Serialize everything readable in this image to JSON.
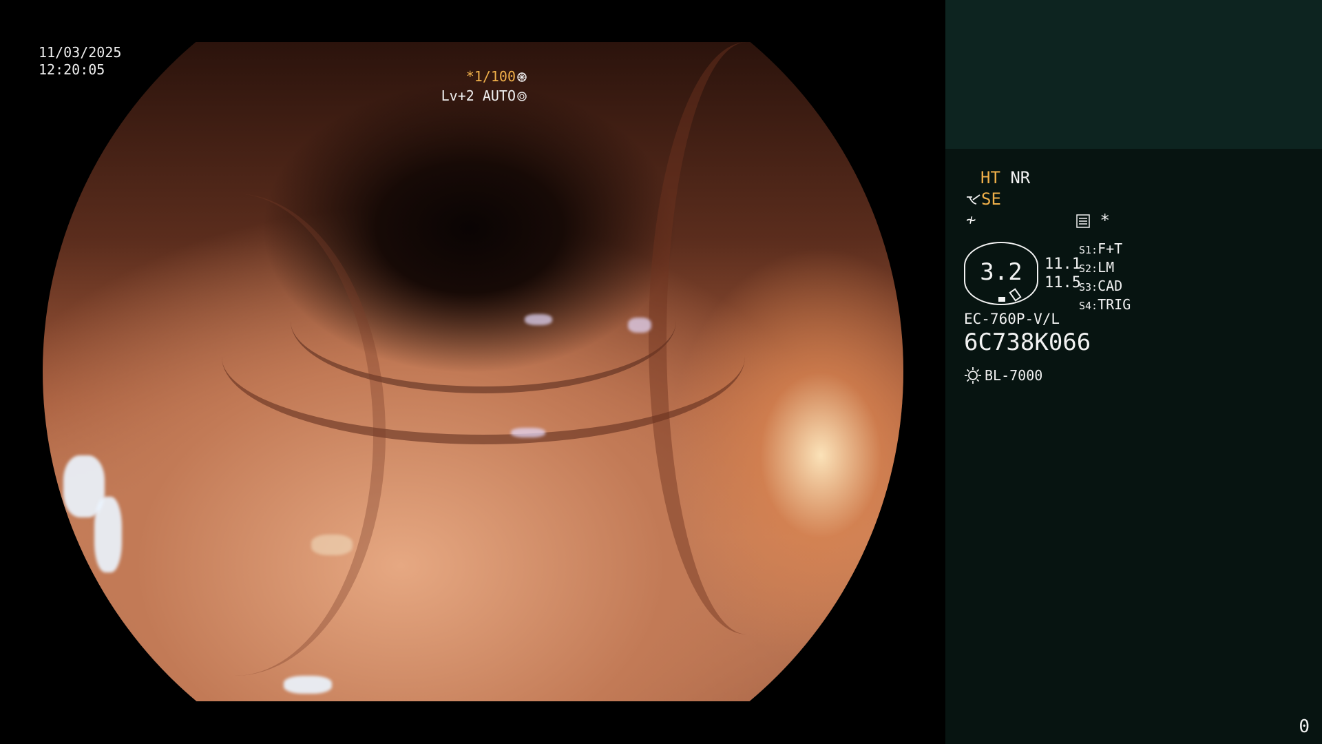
{
  "video": {
    "date": "11/03/2025",
    "time": "12:20:05",
    "shutter": "*1/100",
    "shutter_icon": "shutter-icon",
    "iris": "Lv+2 AUTO",
    "iris_icon": "iris-icon"
  },
  "panel": {
    "ht": "HT",
    "nr": "NR",
    "se": "SE",
    "ce_symbol": "≁",
    "setting_icon": "menu-icon",
    "asterisk": "*",
    "zoom_value": "3.2",
    "side_values": [
      "11.1",
      "11.5"
    ],
    "switches": [
      {
        "key": "S1:",
        "value": "F+T"
      },
      {
        "key": "S2:",
        "value": "LM"
      },
      {
        "key": "S3:",
        "value": "CAD"
      },
      {
        "key": "S4:",
        "value": "TRIG"
      }
    ],
    "scope_model": "EC-760P-V/L",
    "serial": "6C738K066",
    "light_source": "BL-7000",
    "counter": "0"
  },
  "colors": {
    "accent": "#f0b04a",
    "panel_bg": "#071411",
    "panel_top_bg": "#0d2420"
  }
}
